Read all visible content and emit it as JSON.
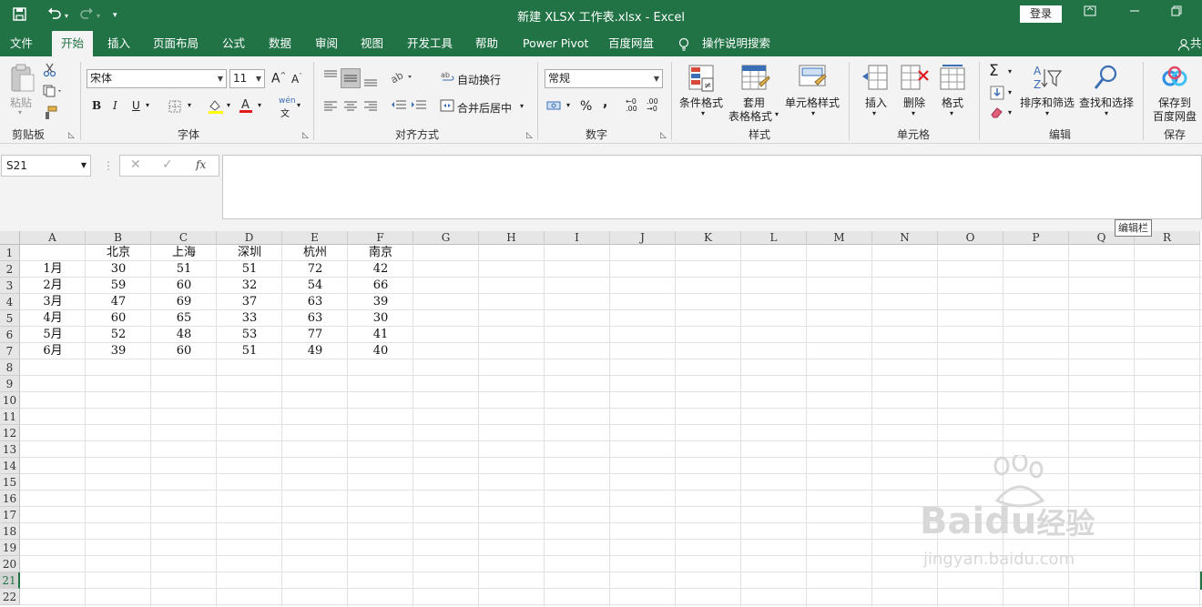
{
  "window": {
    "title": "新建 XLSX 工作表.xlsx  -  Excel",
    "login_label": "登录",
    "share_partial": "共"
  },
  "tabs": [
    {
      "label": "文件"
    },
    {
      "label": "开始"
    },
    {
      "label": "插入"
    },
    {
      "label": "页面布局"
    },
    {
      "label": "公式"
    },
    {
      "label": "数据"
    },
    {
      "label": "审阅"
    },
    {
      "label": "视图"
    },
    {
      "label": "开发工具"
    },
    {
      "label": "帮助"
    },
    {
      "label": "Power Pivot"
    },
    {
      "label": "百度网盘"
    }
  ],
  "tell_me": "操作说明搜索",
  "ribbon": {
    "clipboard": {
      "paste_label": "粘贴",
      "group": "剪贴板"
    },
    "font": {
      "name": "宋体",
      "size": "11",
      "group": "字体",
      "wen_label": "wén",
      "wen_char": "文"
    },
    "alignment": {
      "wrap_label": "自动换行",
      "merge_label": "合并后居中",
      "group": "对齐方式"
    },
    "number": {
      "format": "常规",
      "percent": "%",
      "comma": ",",
      "group": "数字"
    },
    "styles": {
      "cond_format": "条件格式",
      "table_format_1": "套用",
      "table_format_2": "表格格式",
      "cell_styles": "单元格样式",
      "group": "样式"
    },
    "cells": {
      "insert": "插入",
      "delete": "删除",
      "format": "格式",
      "group": "单元格"
    },
    "editing": {
      "sort_filter": "排序和筛选",
      "find_select": "查找和选择",
      "group": "编辑"
    },
    "save": {
      "save_1": "保存到",
      "save_2": "百度网盘",
      "group": "保存"
    }
  },
  "formula_bar": {
    "name_box": "S21",
    "fx": "fx",
    "tooltip": "编辑栏"
  },
  "sheet": {
    "columns": [
      "A",
      "B",
      "C",
      "D",
      "E",
      "F",
      "G",
      "H",
      "I",
      "J",
      "K",
      "L",
      "M",
      "N",
      "O",
      "P",
      "Q",
      "R"
    ],
    "rows": [
      "1",
      "2",
      "3",
      "4",
      "5",
      "6",
      "7",
      "8",
      "9",
      "10",
      "11",
      "12",
      "13",
      "14",
      "15",
      "16",
      "17",
      "18",
      "19",
      "20",
      "21",
      "22"
    ],
    "selected_row": "21",
    "header_row": [
      "",
      "北京",
      "上海",
      "深圳",
      "杭州",
      "南京"
    ],
    "data": [
      [
        "1月",
        "30",
        "51",
        "51",
        "72",
        "42"
      ],
      [
        "2月",
        "59",
        "60",
        "32",
        "54",
        "66"
      ],
      [
        "3月",
        "47",
        "69",
        "37",
        "63",
        "39"
      ],
      [
        "4月",
        "60",
        "65",
        "33",
        "63",
        "30"
      ],
      [
        "5月",
        "52",
        "48",
        "53",
        "77",
        "41"
      ],
      [
        "6月",
        "39",
        "60",
        "51",
        "49",
        "40"
      ]
    ]
  },
  "watermark": {
    "brand": "Bai",
    "brand2": "du",
    "suffix": "经验",
    "url": "jingyan.baidu.com"
  }
}
